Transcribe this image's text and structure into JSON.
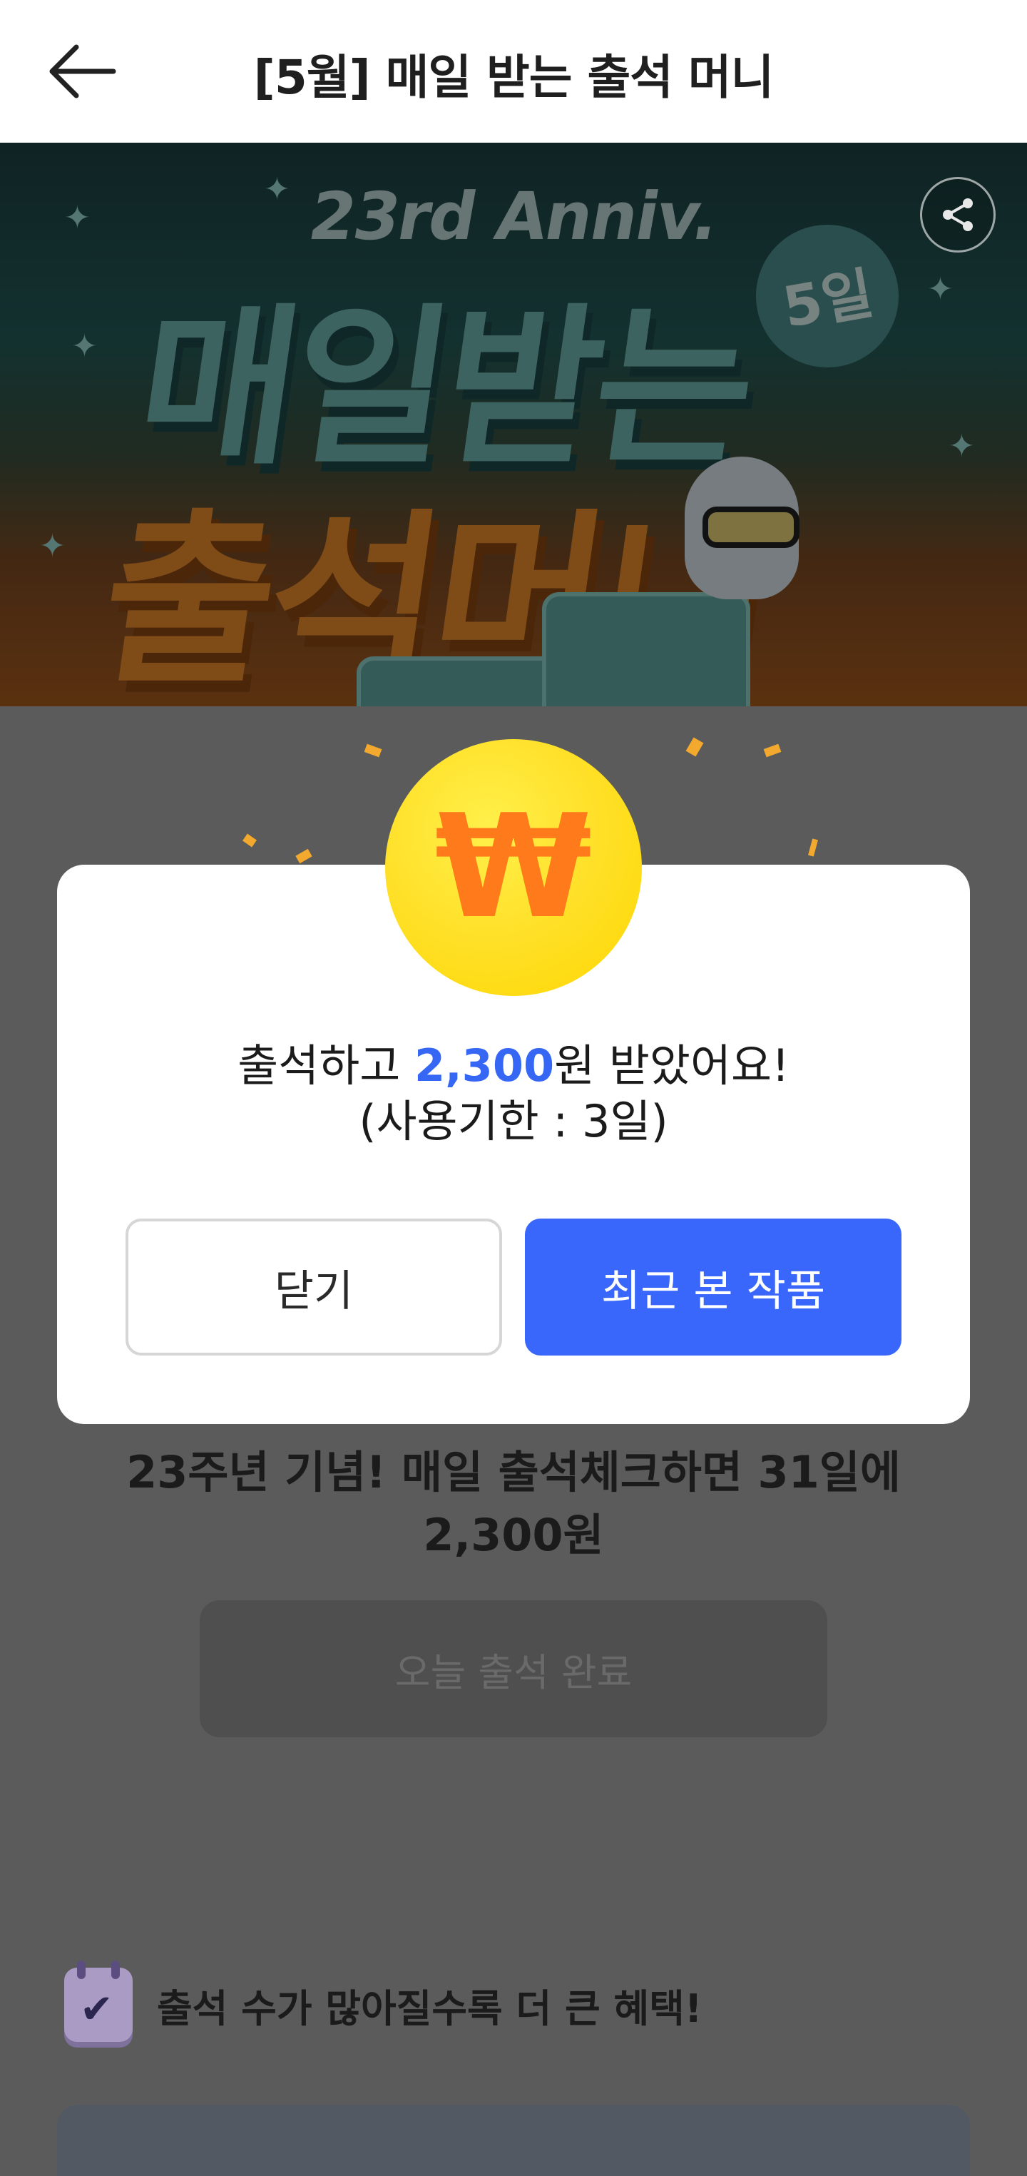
{
  "header": {
    "title": "[5월] 매일 받는 출석 머니"
  },
  "banner": {
    "subtitle": "23rd Anniv.",
    "title_line1": "매일받는",
    "title_line2": "출석머니",
    "day_badge": "5일"
  },
  "main": {
    "promo_line1": "23주년 기념! 매일 출석체크하면 31일에",
    "promo_line2": "2,300원",
    "attend_button": "오늘 출석 완료",
    "benefit_text": "출석 수가 많아질수록 더 큰 혜택!"
  },
  "dialog": {
    "coin_symbol": "₩",
    "message_prefix": "출석하고 ",
    "amount": "2,300",
    "message_suffix": "원 받았어요!",
    "validity": "(사용기한 : 3일)",
    "close_button": "닫기",
    "recent_button": "최근 본 작품",
    "accent_color": "#3a67fb",
    "coin_color": "#ffe12b"
  },
  "icons": {
    "back": "arrow-left-icon",
    "share": "share-icon",
    "calendar": "calendar-check-icon"
  }
}
